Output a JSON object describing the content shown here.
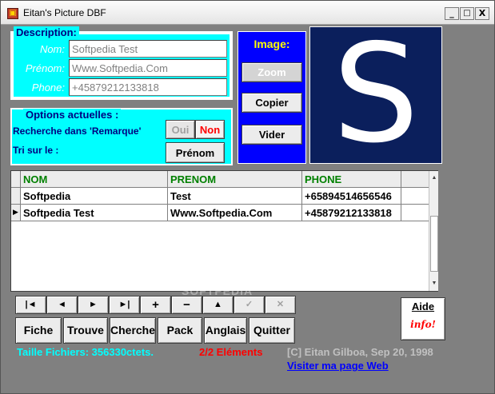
{
  "window": {
    "title": "Eitan's Picture DBF",
    "controls": {
      "minimize": "_",
      "maximize": "□",
      "close": "X"
    }
  },
  "description": {
    "legend": "Description:",
    "nom_label": "Nom:",
    "nom_value": "Softpedia Test",
    "prenom_label": "Prénom:",
    "prenom_value": "Www.Softpedia.Com",
    "phone_label": "Phone:",
    "phone_value": "+45879212133818"
  },
  "options": {
    "legend": "Options actuelles :",
    "search_label": "Recherche dans 'Remarque'",
    "oui": "Oui",
    "non": "Non",
    "sort_label": "Tri sur le :",
    "sort_button": "Prénom",
    "non_color": "#ff0000"
  },
  "image": {
    "title": "Image:",
    "zoom": "Zoom",
    "copier": "Copier",
    "vider": "Vider",
    "preview_letter": "S"
  },
  "grid": {
    "columns": [
      "NOM",
      "PRENOM",
      "PHONE"
    ],
    "rows": [
      {
        "nom": "Softpedia",
        "prenom": "Test",
        "phone": "+65894514656546",
        "current": false
      },
      {
        "nom": "Softpedia Test",
        "prenom": "Www.Softpedia.Com",
        "phone": "+45879212133818",
        "current": true
      }
    ],
    "header_color": "#008000"
  },
  "navigator": {
    "buttons": [
      {
        "name": "first-record-button",
        "glyph": "|◄",
        "enabled": true
      },
      {
        "name": "prior-record-button",
        "glyph": "◄",
        "enabled": true
      },
      {
        "name": "next-record-button",
        "glyph": "►",
        "enabled": true
      },
      {
        "name": "last-record-button",
        "glyph": "►|",
        "enabled": true
      },
      {
        "name": "insert-record-button",
        "glyph": "+",
        "enabled": true
      },
      {
        "name": "delete-record-button",
        "glyph": "−",
        "enabled": true
      },
      {
        "name": "edit-record-button",
        "glyph": "▲",
        "enabled": true
      },
      {
        "name": "post-record-button",
        "glyph": "✓",
        "enabled": false
      },
      {
        "name": "cancel-record-button",
        "glyph": "✕",
        "enabled": false
      }
    ]
  },
  "actions": {
    "fiche": "Fiche",
    "trouve": "Trouve",
    "cherche": "Cherche",
    "pack": "Pack",
    "anglais": "Anglais",
    "quitter": "Quitter"
  },
  "help": {
    "aide": "Aide",
    "info": "info!"
  },
  "status": {
    "file_size": "Taille Fichiers: 356330ctets.",
    "elements": "2/2 Eléments",
    "copyright": "[C] Eitan Gilboa, Sep 20, 1998",
    "link": "Visiter ma page Web"
  },
  "colors": {
    "cyan": "#00ffff",
    "blue": "#0000ff",
    "gray_bg": "#808080",
    "navy": "#000080",
    "status_cyan": "#00ffff",
    "status_red": "#ff0000",
    "copyright_gray": "#c0c0c0",
    "link_blue": "#0000ff"
  },
  "watermark": "SOFTPEDIA"
}
